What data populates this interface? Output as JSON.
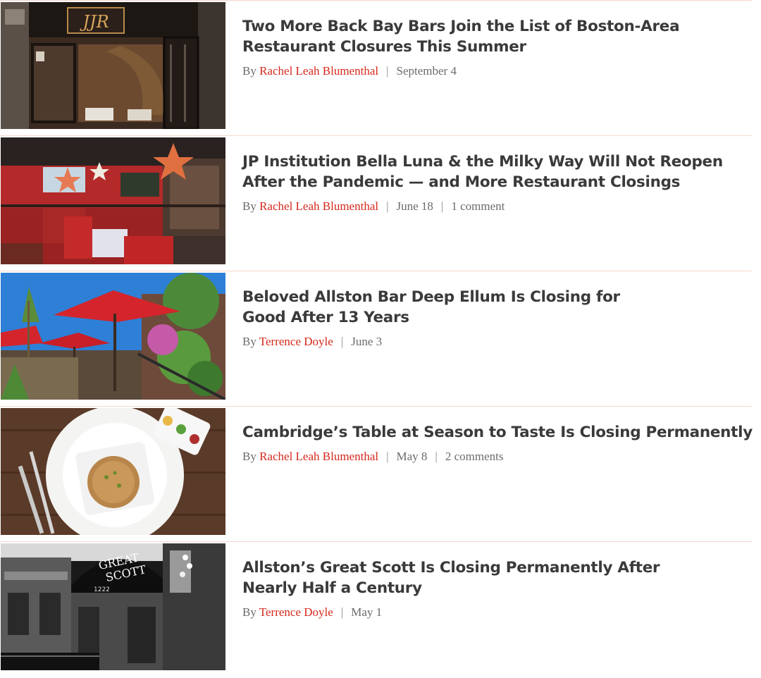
{
  "articles": [
    {
      "headline_lines": [
        "Two More Back Bay Bars Join the List of Boston-Area",
        "Restaurant Closures This Summer"
      ],
      "by": "By",
      "author": "Rachel Leah Blumenthal",
      "date": "September 4",
      "comments": "",
      "image": {
        "sign_text": "JJR"
      }
    },
    {
      "headline_lines": [
        "JP Institution Bella Luna & the Milky Way Will Not Reopen",
        "After the Pandemic — and More Restaurant Closings"
      ],
      "by": "By",
      "author": "Rachel Leah Blumenthal",
      "date": "June 18",
      "comments": "1 comment"
    },
    {
      "headline_lines": [
        "Beloved Allston Bar Deep Ellum Is Closing for",
        "Good After 13 Years"
      ],
      "by": "By",
      "author": "Terrence Doyle",
      "date": "June 3",
      "comments": ""
    },
    {
      "headline_lines": [
        "Cambridge’s Table at Season to Taste Is Closing Permanently"
      ],
      "by": "By",
      "author": "Rachel Leah Blumenthal",
      "date": "May 8",
      "comments": "2 comments"
    },
    {
      "headline_lines": [
        "Allston’s Great Scott Is Closing Permanently After",
        "Nearly Half a Century"
      ],
      "by": "By",
      "author": "Terrence Doyle",
      "date": "May 1",
      "comments": "",
      "image": {
        "sign_text_1": "GREAT",
        "sign_text_2": "SCOTT",
        "address": "1222"
      }
    }
  ]
}
